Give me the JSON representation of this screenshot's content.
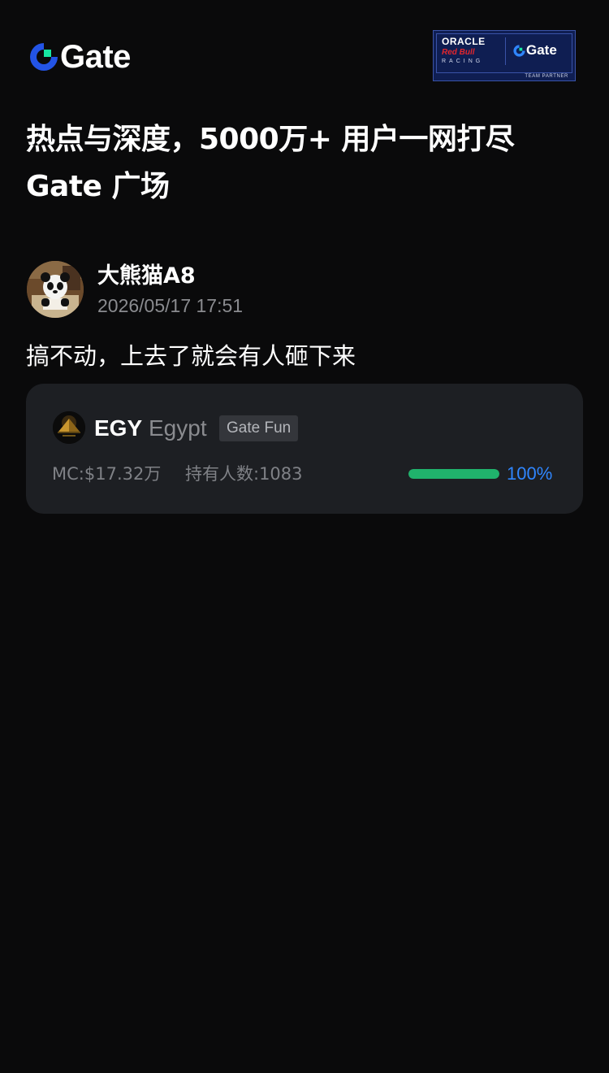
{
  "header": {
    "brand": "Gate",
    "brand_icon": "gate-logo-icon",
    "partner_badge": {
      "line1": "ORACLE",
      "line2": "Red Bull",
      "line3": "RACING",
      "brand": "Gate",
      "tag": "TEAM PARTNER"
    }
  },
  "headline": {
    "line1": "热点与深度，5000万+ 用户一网打尽",
    "line2": "Gate 广场"
  },
  "post": {
    "author": "大熊猫A8",
    "time": "2026/05/17 17:51",
    "text": "搞不动，上去了就会有人砸下来",
    "avatar_icon": "panda-avatar"
  },
  "token": {
    "symbol": "EGY",
    "name": "Egypt",
    "tag": "Gate Fun",
    "market_cap": "MC:$17.32万",
    "holders": "持有人数:1083",
    "progress": 1.0,
    "progress_label": "100%",
    "icon": "egypt-pyramid-icon"
  },
  "colors": {
    "background": "#0a0a0b",
    "card": "#1d1f23",
    "accent_blue": "#2f86ff",
    "progress_green": "#20b26c"
  }
}
